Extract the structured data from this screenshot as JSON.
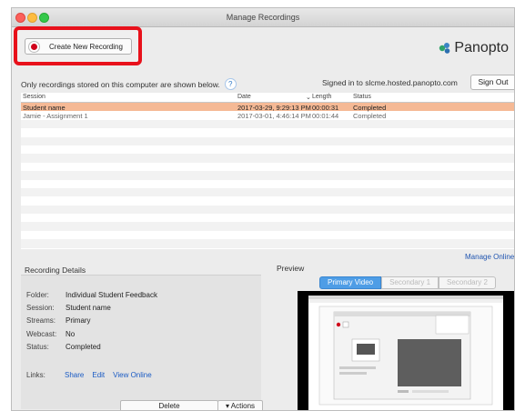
{
  "window": {
    "title": "Manage Recordings"
  },
  "create_button": {
    "label": "Create New Recording"
  },
  "logo": {
    "text": "Panopto"
  },
  "info": {
    "text": "Only recordings stored on this computer are shown below.",
    "help": "?"
  },
  "account": {
    "signed_in_text": "Signed in to slcme.hosted.panopto.com",
    "sign_out_label": "Sign Out"
  },
  "table": {
    "headers": {
      "session": "Session",
      "date": "Date",
      "length": "Length",
      "status": "Status"
    },
    "rows": [
      {
        "session": "Student name",
        "date": "2017-03-29, 9:29:13 PM",
        "length": "00:00:31",
        "status": "Completed"
      },
      {
        "session": "Jamie - Assignment 1",
        "date": "2017-03-01, 4:46:14 PM",
        "length": "00:01:44",
        "status": "Completed"
      }
    ]
  },
  "manage_online": "Manage Online",
  "details": {
    "title": "Recording Details",
    "folder_label": "Folder:",
    "folder": "Individual Student Feedback",
    "session_label": "Session:",
    "session": "Student name",
    "streams_label": "Streams:",
    "streams": "Primary",
    "webcast_label": "Webcast:",
    "webcast": "No",
    "status_label": "Status:",
    "status": "Completed",
    "links_label": "Links:",
    "links": {
      "share": "Share",
      "edit": "Edit",
      "view_online": "View Online"
    },
    "delete_label": "Delete",
    "actions_label": "Actions"
  },
  "preview": {
    "title": "Preview",
    "tabs": {
      "primary": "Primary Video",
      "secondary1": "Secondary 1",
      "secondary2": "Secondary 2"
    }
  },
  "colors": {
    "highlight_box": "#e8111b",
    "selected_row": "#f5b995",
    "active_tab": "#4e9de6",
    "link": "#1a5bc4"
  }
}
